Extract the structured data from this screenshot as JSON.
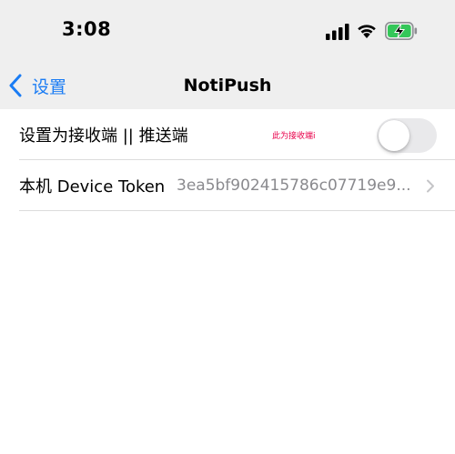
{
  "status_bar": {
    "time": "3:08",
    "icons": [
      "signal-icon",
      "wifi-icon",
      "battery-charging-icon"
    ],
    "battery_color": "#34c759"
  },
  "nav": {
    "back_label": "设置",
    "title": "NotiPush",
    "accent_color": "#1a7cf4"
  },
  "rows": [
    {
      "label": "设置为接收端 || 推送端",
      "note": "此为接收端i",
      "toggle_on": false
    },
    {
      "label": "本机 Device Token",
      "value": "3ea5bf902415786c07719e9...",
      "icon": "chevron-right-icon"
    }
  ]
}
